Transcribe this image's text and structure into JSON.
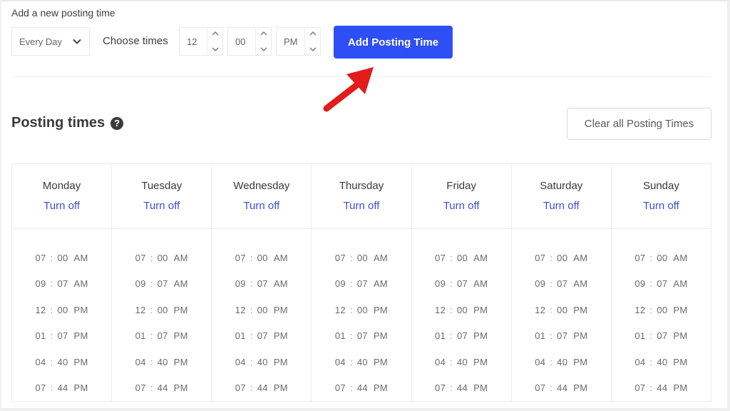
{
  "add_section": {
    "title": "Add a new posting time",
    "frequency_select": {
      "value": "Every Day",
      "icon": "chevron-down-icon"
    },
    "choose_times_label": "Choose times",
    "hour": {
      "value": "12"
    },
    "minute": {
      "value": "00"
    },
    "period": {
      "value": "PM"
    },
    "add_button_label": "Add Posting Time",
    "annotation": {
      "icon": "red-arrow-pointer",
      "color": "#e21b1b"
    }
  },
  "posting_times": {
    "title": "Posting times",
    "help_icon": "?",
    "clear_button_label": "Clear all Posting Times",
    "turn_off_label": "Turn off",
    "days": [
      {
        "name": "Monday",
        "times": [
          [
            "07",
            "00",
            "AM"
          ],
          [
            "09",
            "07",
            "AM"
          ],
          [
            "12",
            "00",
            "PM"
          ],
          [
            "01",
            "07",
            "PM"
          ],
          [
            "04",
            "40",
            "PM"
          ],
          [
            "07",
            "44",
            "PM"
          ]
        ]
      },
      {
        "name": "Tuesday",
        "times": [
          [
            "07",
            "00",
            "AM"
          ],
          [
            "09",
            "07",
            "AM"
          ],
          [
            "12",
            "00",
            "PM"
          ],
          [
            "01",
            "07",
            "PM"
          ],
          [
            "04",
            "40",
            "PM"
          ],
          [
            "07",
            "44",
            "PM"
          ]
        ]
      },
      {
        "name": "Wednesday",
        "times": [
          [
            "07",
            "00",
            "AM"
          ],
          [
            "09",
            "07",
            "AM"
          ],
          [
            "12",
            "00",
            "PM"
          ],
          [
            "01",
            "07",
            "PM"
          ],
          [
            "04",
            "40",
            "PM"
          ],
          [
            "07",
            "44",
            "PM"
          ]
        ]
      },
      {
        "name": "Thursday",
        "times": [
          [
            "07",
            "00",
            "AM"
          ],
          [
            "09",
            "07",
            "AM"
          ],
          [
            "12",
            "00",
            "PM"
          ],
          [
            "01",
            "07",
            "PM"
          ],
          [
            "04",
            "40",
            "PM"
          ],
          [
            "07",
            "44",
            "PM"
          ]
        ]
      },
      {
        "name": "Friday",
        "times": [
          [
            "07",
            "00",
            "AM"
          ],
          [
            "09",
            "07",
            "AM"
          ],
          [
            "12",
            "00",
            "PM"
          ],
          [
            "01",
            "07",
            "PM"
          ],
          [
            "04",
            "40",
            "PM"
          ],
          [
            "07",
            "44",
            "PM"
          ]
        ]
      },
      {
        "name": "Saturday",
        "times": [
          [
            "07",
            "00",
            "AM"
          ],
          [
            "09",
            "07",
            "AM"
          ],
          [
            "12",
            "00",
            "PM"
          ],
          [
            "01",
            "07",
            "PM"
          ],
          [
            "04",
            "40",
            "PM"
          ],
          [
            "07",
            "44",
            "PM"
          ]
        ]
      },
      {
        "name": "Sunday",
        "times": [
          [
            "07",
            "00",
            "AM"
          ],
          [
            "09",
            "07",
            "AM"
          ],
          [
            "12",
            "00",
            "PM"
          ],
          [
            "01",
            "07",
            "PM"
          ],
          [
            "04",
            "40",
            "PM"
          ],
          [
            "07",
            "44",
            "PM"
          ]
        ]
      }
    ]
  },
  "colors": {
    "primary": "#2e4ff5",
    "link": "#3a4fd6",
    "arrow": "#e21b1b"
  }
}
